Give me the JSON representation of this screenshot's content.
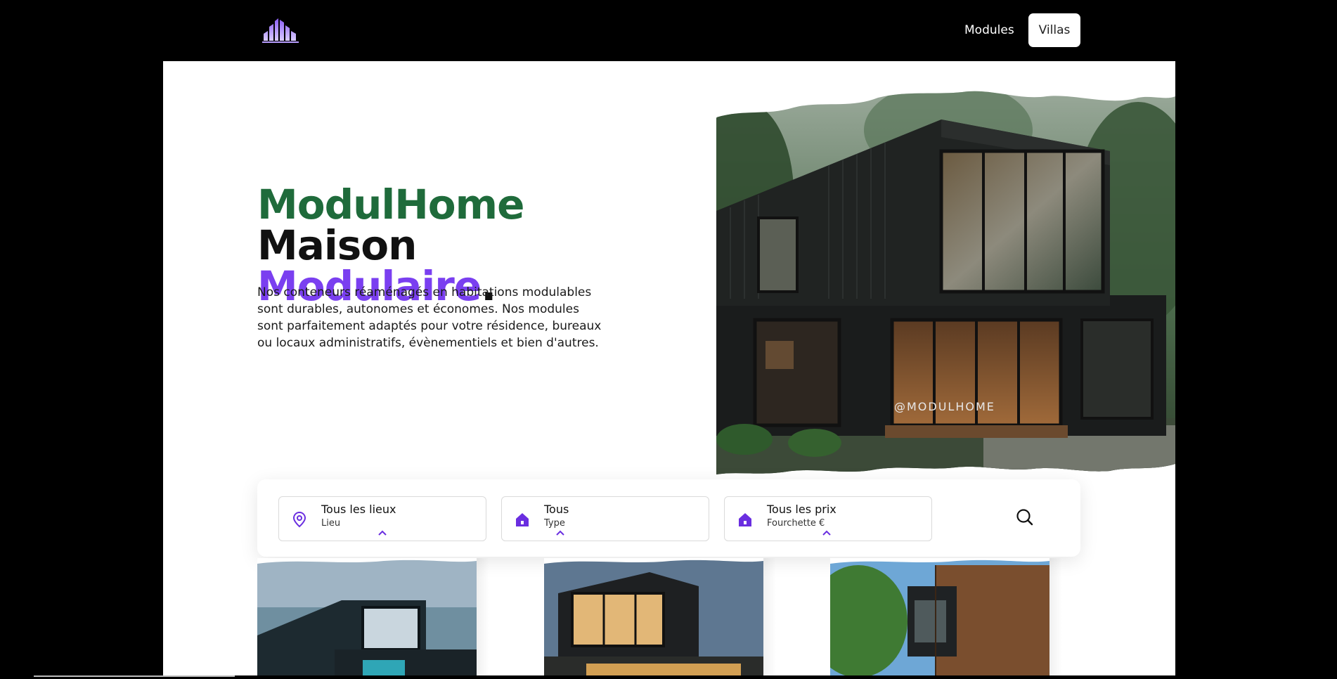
{
  "header": {
    "logo": "buildings-logo-icon",
    "nav": {
      "modules_label": "Modules",
      "villas_label": "Villas"
    }
  },
  "hero": {
    "title_part1": "ModulHome",
    "title_part2": " Maison",
    "title_part3": "Modulaire",
    "title_part4": ".",
    "description": "Nos conteneurs réaménagés en habitations modulables sont durables, autonomes et économes. Nos modules sont parfaitement adaptés pour votre résidence, bureaux ou locaux administratifs, évènementiels et bien d'autres.",
    "watermark": "@MODULHOME"
  },
  "search": {
    "fields": [
      {
        "title": "Tous les lieux",
        "subtitle": "Lieu",
        "icon": "location-pin-icon"
      },
      {
        "title": "Tous",
        "subtitle": "Type",
        "icon": "house-icon"
      },
      {
        "title": "Tous les prix",
        "subtitle": "Fourchette €",
        "icon": "house-icon"
      }
    ],
    "button_icon": "search-icon"
  },
  "colors": {
    "accent_purple": "#7a3ff0",
    "brand_green": "#1f6b3b",
    "icon_purple": "#6a2ee0",
    "background": "#000000"
  }
}
